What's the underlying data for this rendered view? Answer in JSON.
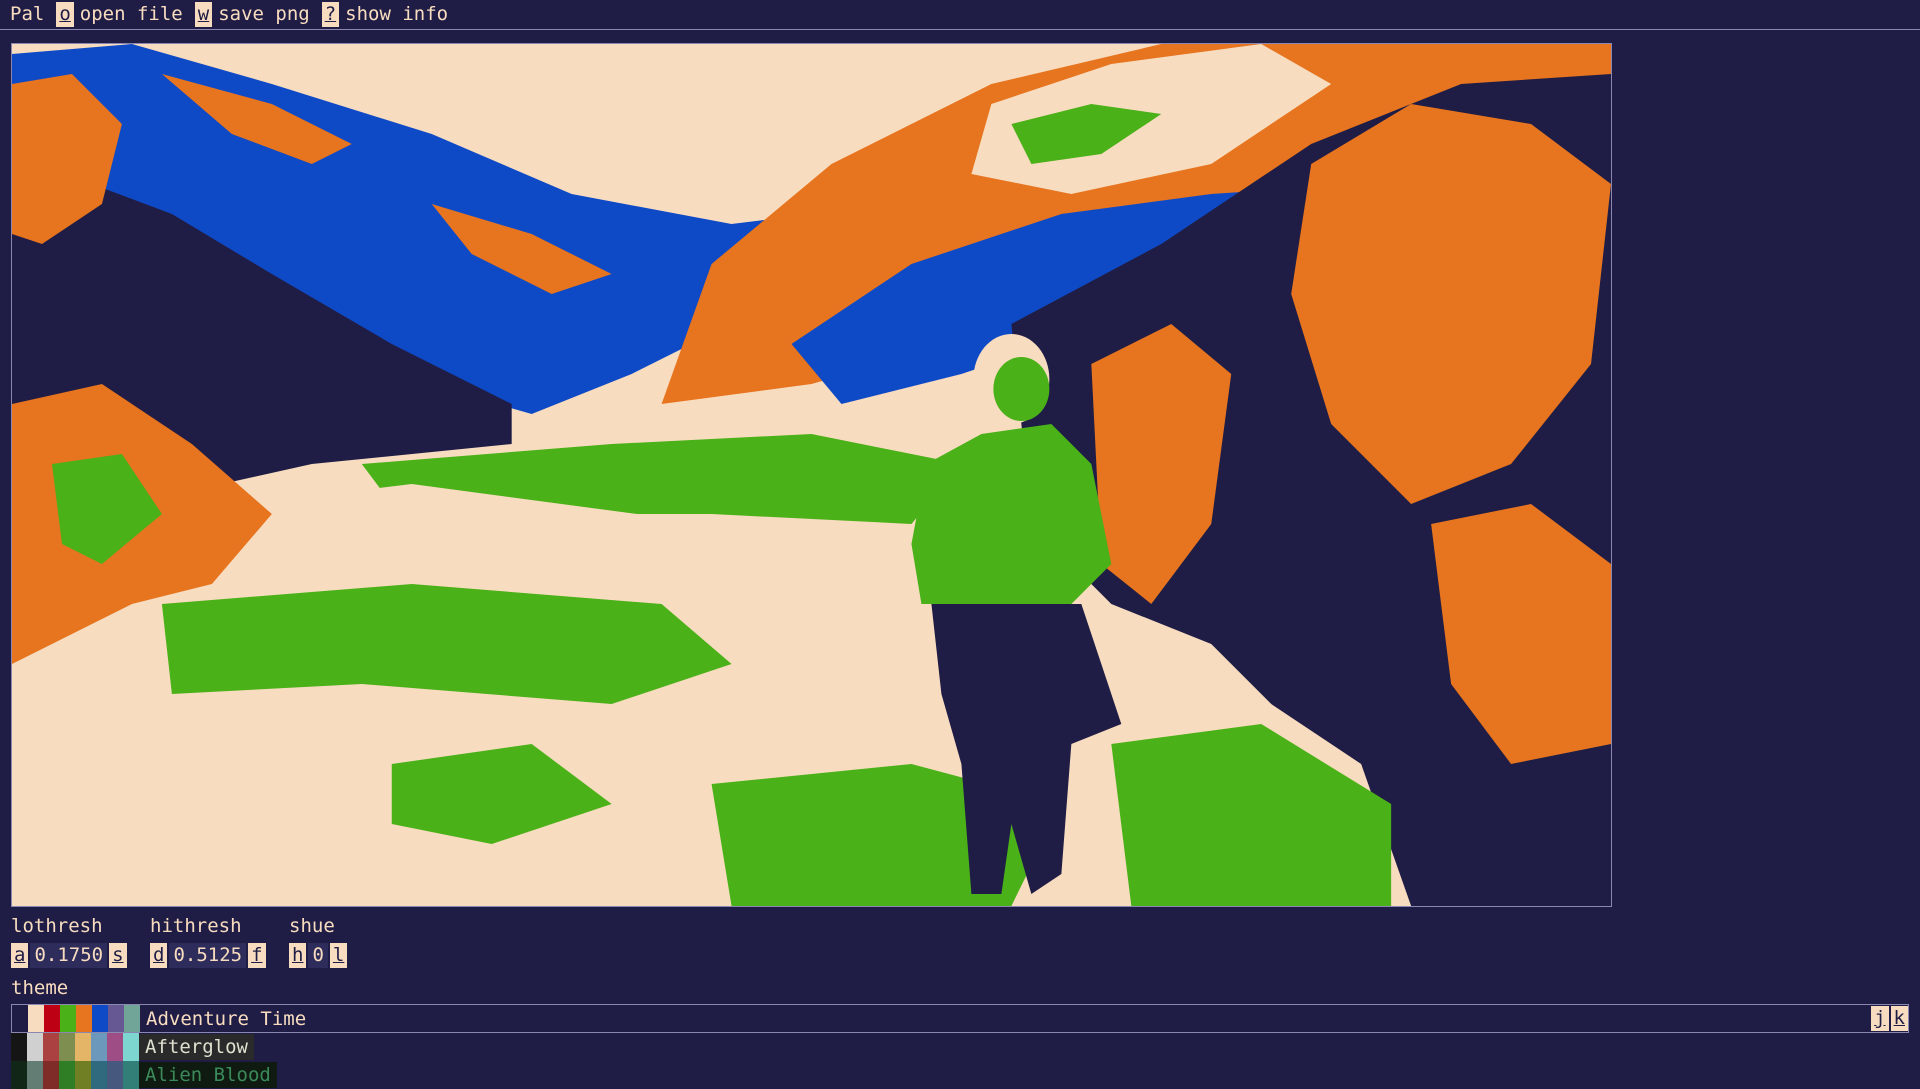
{
  "topbar": {
    "app_name": "Pal",
    "open": {
      "key": "o",
      "label": "open file"
    },
    "save": {
      "key": "w",
      "label": "save png"
    },
    "info": {
      "key": "?",
      "label": "show info"
    }
  },
  "controls": {
    "lothresh": {
      "title": "lothresh",
      "dec_key": "a",
      "value": "0.1750",
      "inc_key": "s"
    },
    "hithresh": {
      "title": "hithresh",
      "dec_key": "d",
      "value": "0.5125",
      "inc_key": "f"
    },
    "shue": {
      "title": "shue",
      "dec_key": "h",
      "value": "0",
      "inc_key": "l"
    }
  },
  "theme": {
    "label": "theme",
    "nav_up_key": "j",
    "nav_down_key": "k",
    "items": [
      {
        "name": "Adventure Time",
        "selected": true,
        "swatches": [
          "#1f1d45",
          "#f8dcc0",
          "#bd0013",
          "#4ab118",
          "#e7741e",
          "#0f4ac6",
          "#665993",
          "#70a598"
        ]
      },
      {
        "name": "Afterglow",
        "selected": false,
        "swatches": [
          "#151515",
          "#d0d0d0",
          "#ac4142",
          "#7e8e50",
          "#e5b567",
          "#6c99bb",
          "#9f4e85",
          "#7dd6cf"
        ]
      },
      {
        "name": "Alien Blood",
        "selected": false,
        "swatches": [
          "#112616",
          "#637d75",
          "#7f2b27",
          "#2f7e25",
          "#717f24",
          "#2f6a7f",
          "#47587f",
          "#327f77"
        ]
      }
    ]
  },
  "colors": {
    "background": "#1f1d45",
    "cream": "#f8dcc0",
    "blue": "#0f4ac6",
    "orange": "#e7741e",
    "green": "#4ab118"
  }
}
